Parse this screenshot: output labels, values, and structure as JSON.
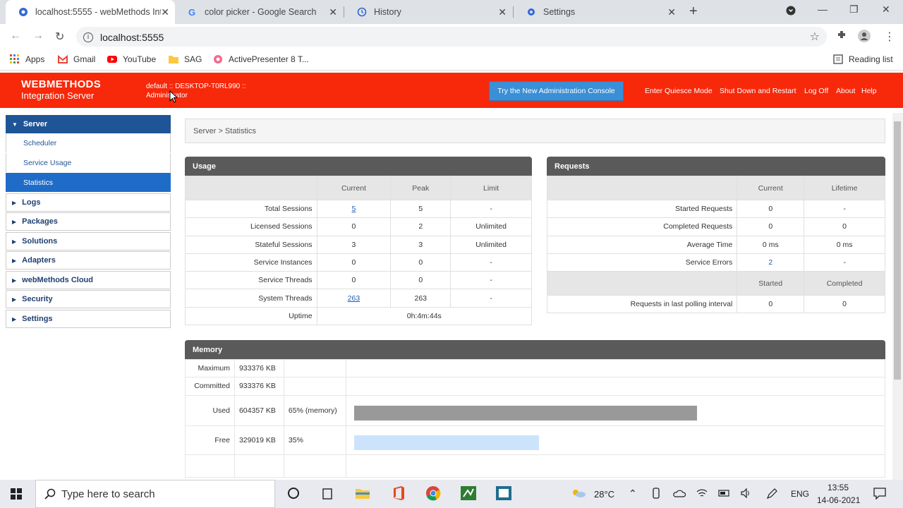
{
  "browser": {
    "tabs": [
      {
        "title": "localhost:5555 - webMethods Int",
        "active": true
      },
      {
        "title": "color picker - Google Search",
        "active": false
      },
      {
        "title": "History",
        "active": false
      },
      {
        "title": "Settings",
        "active": false
      }
    ],
    "url": "localhost:5555",
    "bookmarks": [
      "Apps",
      "Gmail",
      "YouTube",
      "SAG",
      "ActivePresenter 8 T..."
    ],
    "reading_list": "Reading list"
  },
  "wm": {
    "logo_line1": "WEBMETHODS",
    "logo_line2": "Integration Server",
    "server_info": "default :: DESKTOP-T0RL990 :: Administrator",
    "new_console_button": "Try the New Administration Console",
    "links": [
      "Enter Quiesce Mode",
      "Shut Down and Restart",
      "Log Off",
      "About",
      "Help"
    ]
  },
  "sidebar": {
    "server": "Server",
    "server_items": [
      "Scheduler",
      "Service Usage",
      "Statistics"
    ],
    "sections": [
      "Logs",
      "Packages",
      "Solutions",
      "Adapters",
      "webMethods Cloud",
      "Security",
      "Settings"
    ]
  },
  "breadcrumb": "Server > Statistics",
  "usage": {
    "title": "Usage",
    "columns": [
      "Current",
      "Peak",
      "Limit"
    ],
    "rows": [
      {
        "label": "Total Sessions",
        "current": "5",
        "peak": "5",
        "limit": "-"
      },
      {
        "label": "Licensed Sessions",
        "current": "0",
        "peak": "2",
        "limit": "Unlimited"
      },
      {
        "label": "Stateful Sessions",
        "current": "3",
        "peak": "3",
        "limit": "Unlimited"
      },
      {
        "label": "Service Instances",
        "current": "0",
        "peak": "0",
        "limit": "-"
      },
      {
        "label": "Service Threads",
        "current": "0",
        "peak": "0",
        "limit": "-"
      },
      {
        "label": "System Threads",
        "current": "263",
        "peak": "263",
        "limit": "-"
      }
    ],
    "uptime_label": "Uptime",
    "uptime_value": "0h:4m:44s"
  },
  "requests": {
    "title": "Requests",
    "columns": [
      "Current",
      "Lifetime"
    ],
    "rows": [
      {
        "label": "Started Requests",
        "current": "0",
        "lifetime": "-"
      },
      {
        "label": "Completed Requests",
        "current": "0",
        "lifetime": "0"
      },
      {
        "label": "Average Time",
        "current": "0 ms",
        "lifetime": "0 ms"
      },
      {
        "label": "Service Errors",
        "current": "2",
        "lifetime": "-"
      }
    ],
    "polling_columns": [
      "Started",
      "Completed"
    ],
    "polling_label": "Requests in last polling interval",
    "polling_started": "0",
    "polling_completed": "0"
  },
  "memory": {
    "title": "Memory",
    "maximum_label": "Maximum",
    "maximum_value": "933376 KB",
    "committed_label": "Committed",
    "committed_value": "933376 KB",
    "used_label": "Used",
    "used_value": "604357 KB",
    "used_pct": "65% (memory)",
    "free_label": "Free",
    "free_value": "329019 KB",
    "free_pct": "35%",
    "used_fraction": 0.65,
    "free_fraction": 0.35,
    "used_color": "#999999",
    "free_color": "#cce4fb"
  },
  "taskbar": {
    "search_placeholder": "Type here to search",
    "weather": "28°C",
    "language": "ENG",
    "time": "13:55",
    "date": "14-06-2021"
  },
  "colors": {
    "header_red": "#f8280a",
    "nav_blue": "#1f5496",
    "button_blue": "#3a8fd6"
  }
}
